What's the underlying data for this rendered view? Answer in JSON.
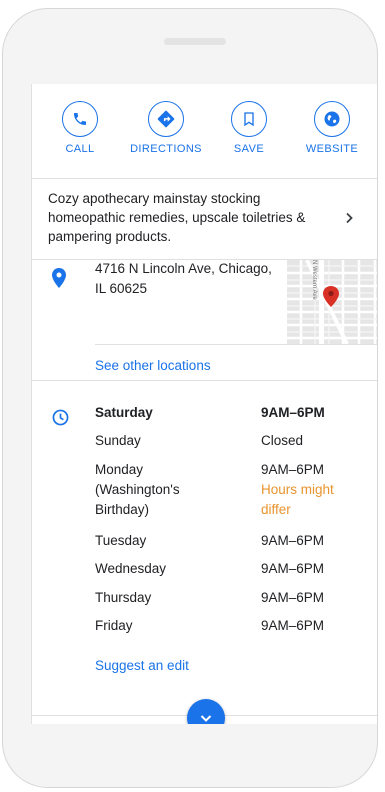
{
  "actions": {
    "call": "CALL",
    "directions": "DIRECTIONS",
    "save": "SAVE",
    "website": "WEBSITE"
  },
  "description": "Cozy apothecary mainstay stocking homeopathic remedies, upscale toiletries & pampering products.",
  "address": "4716 N Lincoln Ave, Chicago, IL 60625",
  "map": {
    "street_label": "N Western Ave"
  },
  "other_locations": "See other locations",
  "hours": [
    {
      "day": "Saturday",
      "time": "9AM–6PM",
      "bold": true
    },
    {
      "day": "Sunday",
      "time": "Closed"
    },
    {
      "day": "Monday (Washington's Birthday)",
      "time": "9AM–6PM",
      "note": "Hours might differ"
    },
    {
      "day": "Tuesday",
      "time": "9AM–6PM"
    },
    {
      "day": "Wednesday",
      "time": "9AM–6PM"
    },
    {
      "day": "Thursday",
      "time": "9AM–6PM"
    },
    {
      "day": "Friday",
      "time": "9AM–6PM"
    }
  ],
  "suggest_edit": "Suggest an edit",
  "colors": {
    "accent": "#1a73e8",
    "warning": "#e8942e",
    "map_pin": "#d93025"
  }
}
